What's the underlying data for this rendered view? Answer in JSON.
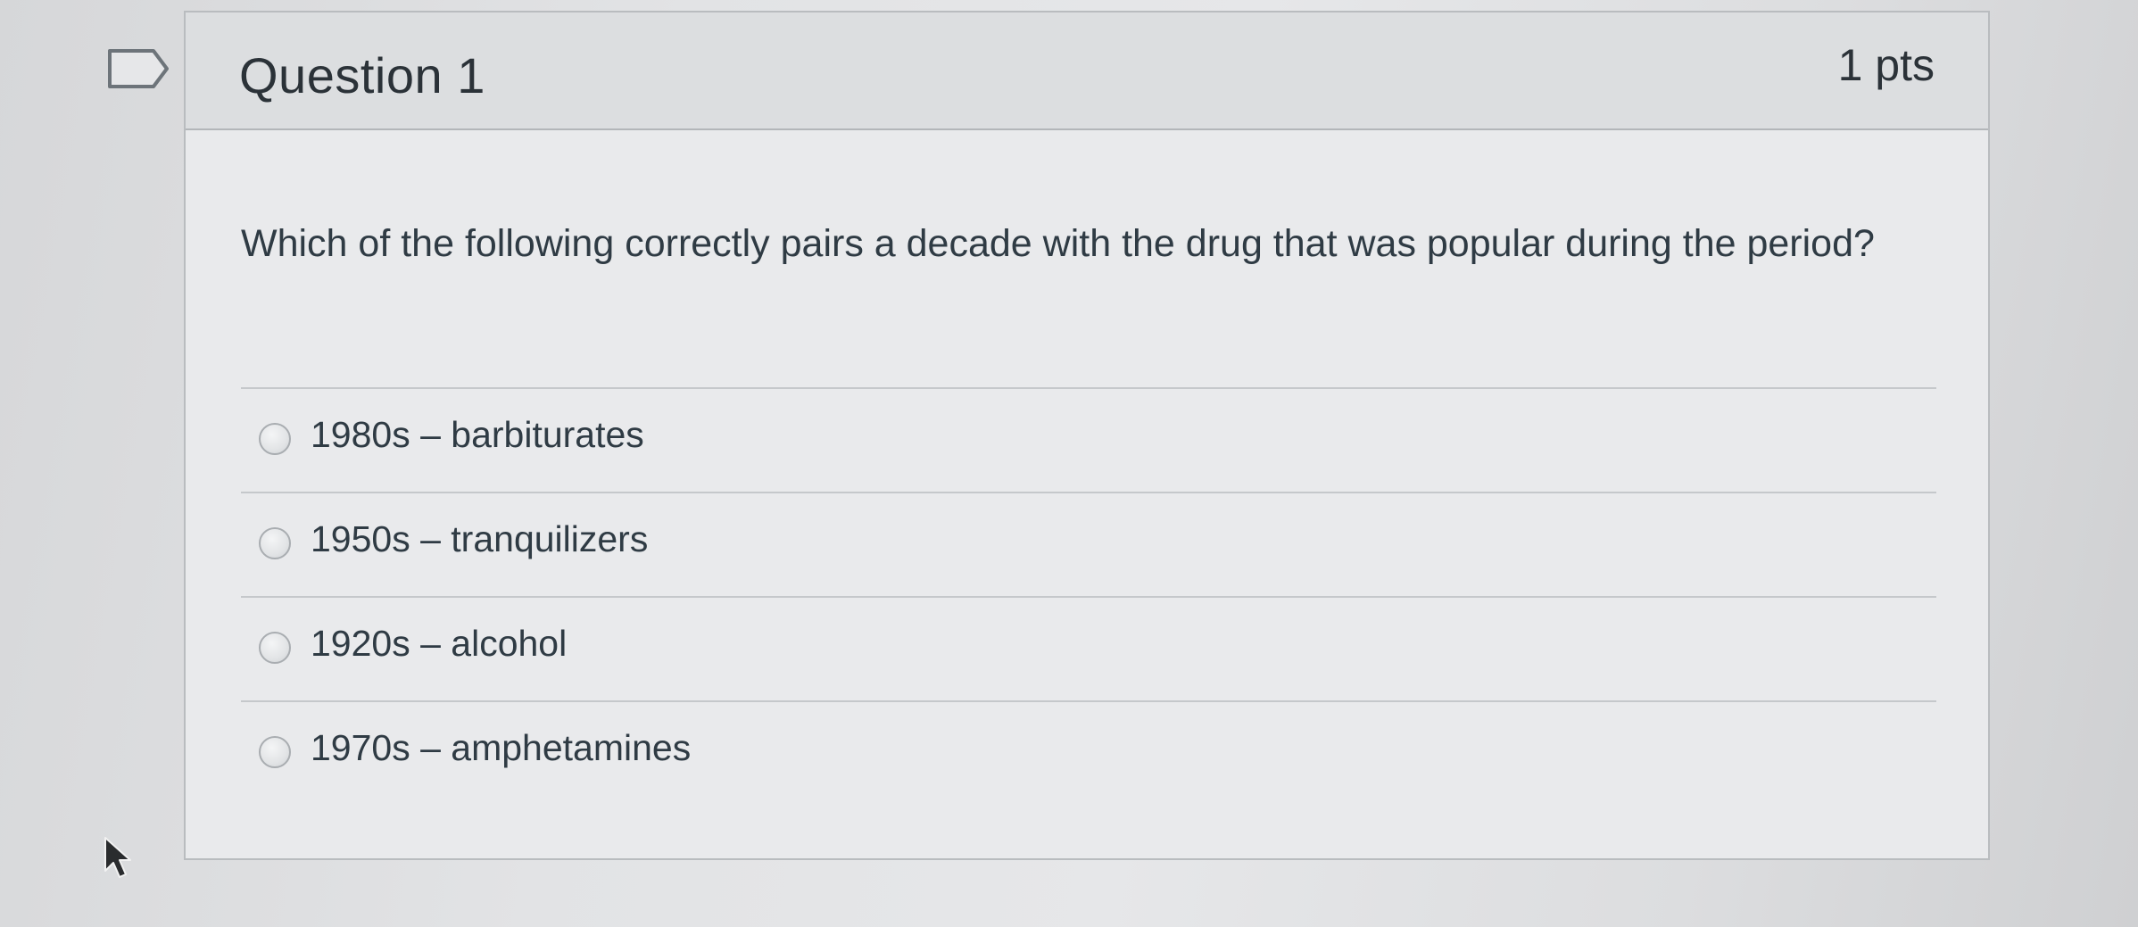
{
  "question": {
    "title": "Question 1",
    "points": "1 pts",
    "prompt": "Which of the following correctly pairs a decade with the drug that was popular during the period?"
  },
  "answers": [
    {
      "label": "1980s – barbiturates",
      "selected": false
    },
    {
      "label": "1950s – tranquilizers",
      "selected": false
    },
    {
      "label": "1920s – alcohol",
      "selected": false
    },
    {
      "label": "1970s – amphetamines",
      "selected": false
    }
  ],
  "icons": {
    "flag": "flag-icon",
    "cursor": "mouse-pointer-icon"
  }
}
